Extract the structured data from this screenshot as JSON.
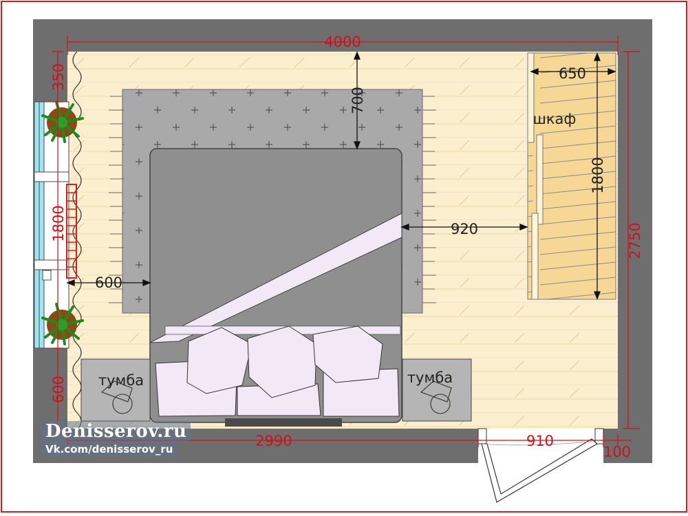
{
  "dimensions": {
    "room_width": "4000",
    "room_depth": "2750",
    "wall_top_segment": "350",
    "window_width": "1800",
    "wall_bottom_segment": "600",
    "bed_to_wall_left": "600",
    "bed_to_wall_top": "700",
    "bed_to_wardrobe": "920",
    "wardrobe_depth": "650",
    "wardrobe_length": "1800",
    "wall_to_door": "2990",
    "door_width": "910",
    "door_offset": "100"
  },
  "labels": {
    "wardrobe": "шкаф",
    "nightstand_left": "тумба",
    "nightstand_right": "тумба"
  },
  "watermark": {
    "title": "Denisserov.ru",
    "subtitle": "Vk.com/denisserov_ru"
  },
  "colors": {
    "wall": "#6e6e6e",
    "floor": "#fcefd0",
    "dimension": "#d0101a",
    "rug": "#a9a9a9",
    "bed": "#8f8f8f",
    "wardrobe": "#f6d796",
    "window": "#9fe4f2"
  }
}
